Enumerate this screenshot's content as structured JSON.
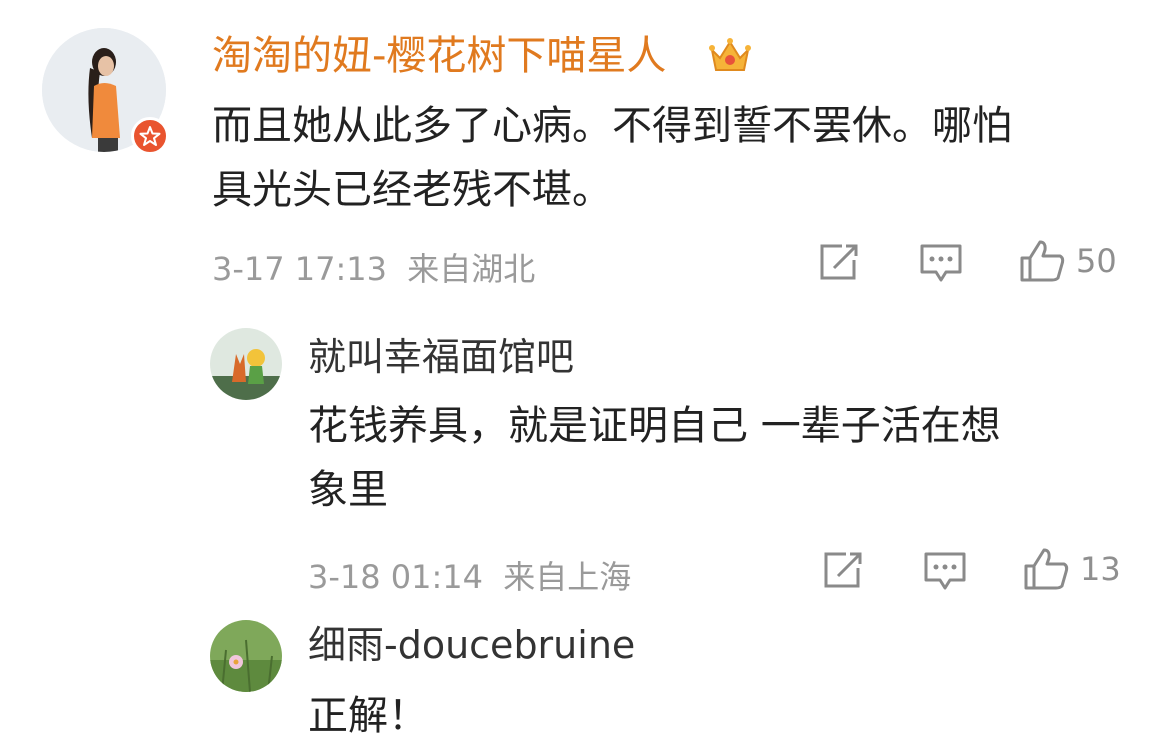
{
  "comments": [
    {
      "author": "淘淘的妞-樱花树下喵星人",
      "author_color": "#e07a1f",
      "has_crown_badge": true,
      "has_verified_badge": true,
      "text_lines": [
        "而且她从此多了心病。不得到誓不罢休。哪怕",
        "具光头已经老残不堪。"
      ],
      "time": "3-17 17:13",
      "location": "来自湖北",
      "like_count": "50"
    },
    {
      "author": "就叫幸福面馆吧",
      "author_color": "#333333",
      "text_lines": [
        "花钱养具，就是证明自己 一辈子活在想",
        "象里"
      ],
      "time": "3-18 01:14",
      "location": "来自上海",
      "like_count": "13"
    },
    {
      "author": "细雨-doucebruine",
      "author_color": "#333333",
      "text_lines": [
        "正解！"
      ]
    }
  ],
  "icons": {
    "share": "share-icon",
    "reply": "comment-icon",
    "like": "thumbs-up-icon",
    "crown": "crown-badge-icon",
    "verified": "verified-badge-icon"
  }
}
